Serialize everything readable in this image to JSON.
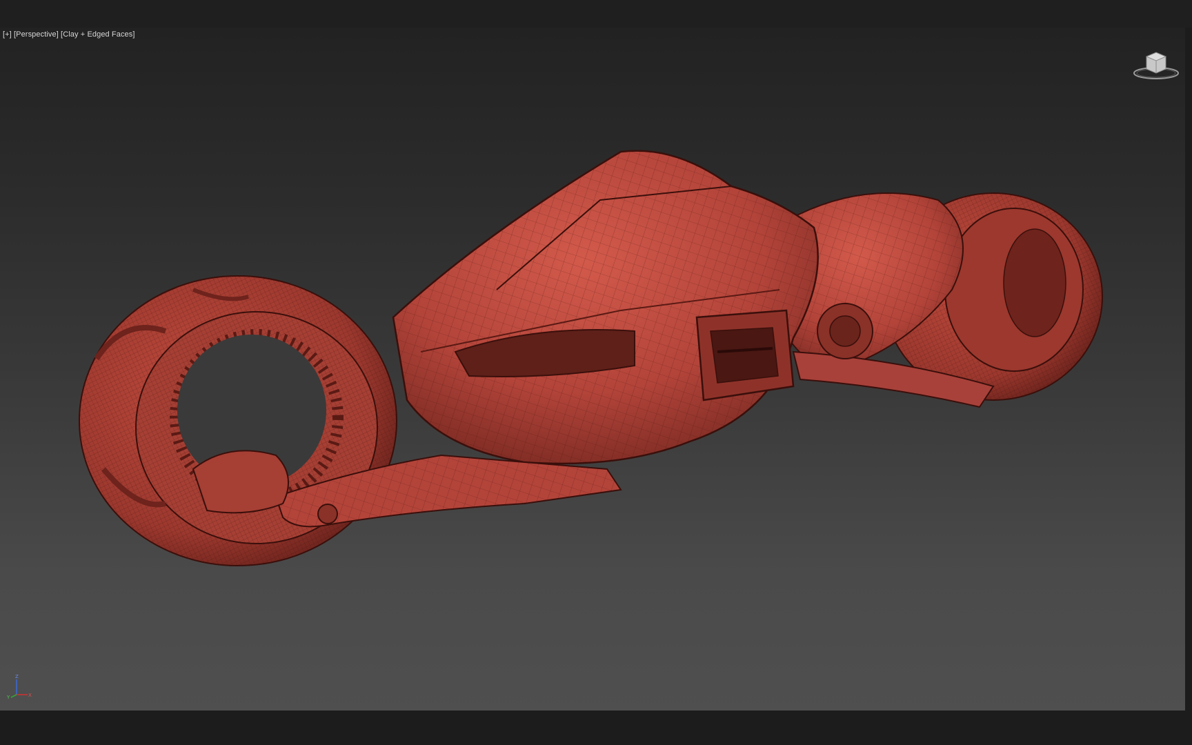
{
  "viewport": {
    "label_plus": "[+]",
    "label_view": "[Perspective]",
    "label_shading": "[Clay + Edged Faces]"
  },
  "viewcube": {
    "icon": "viewcube-icon"
  },
  "axis_tripod": {
    "z_label": "Z",
    "x_label": "X",
    "y_label": "Y"
  },
  "colors": {
    "model_main": "#b8463a",
    "model_light": "#d0584a",
    "model_dark": "#6e231c",
    "edge": "#3a0f0b",
    "axis_x": "#d03030",
    "axis_y": "#30b030",
    "axis_z": "#3a6ad8"
  }
}
